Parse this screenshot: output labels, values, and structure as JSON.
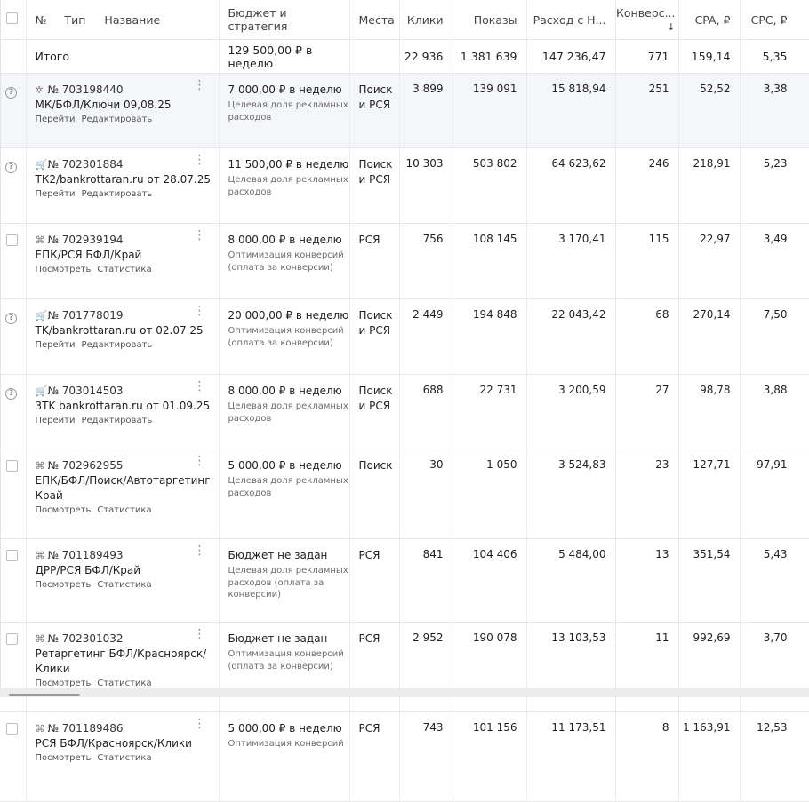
{
  "header": {
    "num": "№",
    "type": "Тип",
    "name": "Название",
    "budget": "Бюджет и стратегия",
    "places": "Места",
    "clicks": "Клики",
    "shows": "Показы",
    "spend": "Расход с Н...",
    "conv": "Конверс...",
    "sort_icon": "↓",
    "cpa": "CPA, ₽",
    "cpc": "CPC, ₽"
  },
  "total": {
    "label": "Итого",
    "budget": "129 500,00 ₽ в неделю",
    "clicks": "22 936",
    "shows": "1 381 639",
    "spend": "147 236,47",
    "conv": "771",
    "cpa": "159,14",
    "cpc": "5,35"
  },
  "rows": [
    {
      "status": "question-icon",
      "type_icon": "✲",
      "id": "№ 703198440",
      "name": "МК/БФЛ/Ключи 09,08.25",
      "link1": "Перейти",
      "link2": "Редактировать",
      "budget": "7 000,00 ₽ в неделю",
      "strategy": "Целевая доля рекламных расходов",
      "places": "Поиск и РСЯ",
      "clicks": "3 899",
      "shows": "139 091",
      "spend": "15 818,94",
      "conv": "251",
      "cpa": "52,52",
      "cpc": "3,38"
    },
    {
      "status": "question-icon",
      "type_icon": "🛒",
      "id": "№ 702301884",
      "name": "ТК2/bankrottaran.ru от 28.07.25",
      "link1": "Перейти",
      "link2": "Редактировать",
      "budget": "11 500,00 ₽ в неделю",
      "strategy": "Целевая доля рекламных расходов",
      "places": "Поиск и РСЯ",
      "clicks": "10 303",
      "shows": "503 802",
      "spend": "64 623,62",
      "conv": "246",
      "cpa": "218,91",
      "cpc": "5,23"
    },
    {
      "status": "checkbox",
      "type_icon": "⌘",
      "id": "№ 702939194",
      "name": "ЕПК/РСЯ БФЛ/Край",
      "link1": "Посмотреть",
      "link2": "Статистика",
      "budget": "8 000,00 ₽ в неделю",
      "strategy": "Оптимизация конверсий (оплата за конверсии)",
      "places": "РСЯ",
      "clicks": "756",
      "shows": "108 145",
      "spend": "3 170,41",
      "conv": "115",
      "cpa": "22,97",
      "cpc": "3,49"
    },
    {
      "status": "question-icon",
      "type_icon": "🛒",
      "id": "№ 701778019",
      "name": "TK/bankrottaran.ru от 02.07.25",
      "link1": "Перейти",
      "link2": "Редактировать",
      "budget": "20 000,00 ₽ в неделю",
      "strategy": "Оптимизация конверсий (оплата за конверсии)",
      "places": "Поиск и РСЯ",
      "clicks": "2 449",
      "shows": "194 848",
      "spend": "22 043,42",
      "conv": "68",
      "cpa": "270,14",
      "cpc": "7,50"
    },
    {
      "status": "question-icon",
      "type_icon": "🛒",
      "id": "№ 703014503",
      "name": "3TK bankrottaran.ru от 01.09.25",
      "link1": "Перейти",
      "link2": "Редактировать",
      "budget": "8 000,00 ₽ в неделю",
      "strategy": "Целевая доля рекламных расходов",
      "places": "Поиск и РСЯ",
      "clicks": "688",
      "shows": "22 731",
      "spend": "3 200,59",
      "conv": "27",
      "cpa": "98,78",
      "cpc": "3,88"
    },
    {
      "status": "checkbox",
      "type_icon": "⌘",
      "id": "№ 702962955",
      "name": "ЕПК/БФЛ/Поиск/Автотаргетинг Край",
      "link1": "Посмотреть",
      "link2": "Статистика",
      "budget": "5 000,00 ₽ в неделю",
      "strategy": "Целевая доля рекламных расходов",
      "places": "Поиск",
      "clicks": "30",
      "shows": "1 050",
      "spend": "3 524,83",
      "conv": "23",
      "cpa": "127,71",
      "cpc": "97,91"
    },
    {
      "status": "checkbox",
      "type_icon": "⌘",
      "id": "№ 701189493",
      "name": "ДРР/РСЯ БФЛ/Край",
      "link1": "Посмотреть",
      "link2": "Статистика",
      "budget": "Бюджет не задан",
      "strategy": "Целевая доля рекламных расходов (оплата за конверсии)",
      "places": "РСЯ",
      "clicks": "841",
      "shows": "104 406",
      "spend": "5 484,00",
      "conv": "13",
      "cpa": "351,54",
      "cpc": "5,43"
    },
    {
      "status": "checkbox",
      "type_icon": "⌘",
      "id": "№ 702301032",
      "name": "Ретаргетинг БФЛ/Красноярск/ Клики",
      "link1": "Посмотреть",
      "link2": "Статистика",
      "budget": "Бюджет не задан",
      "strategy": "Оптимизация конверсий (оплата за конверсии)",
      "places": "РСЯ",
      "clicks": "2 952",
      "shows": "190 078",
      "spend": "13 103,53",
      "conv": "11",
      "cpa": "992,69",
      "cpc": "3,70"
    },
    {
      "status": "checkbox",
      "type_icon": "⌘",
      "id": "№ 701189486",
      "name": "РСЯ БФЛ/Красноярск/Клики",
      "link1": "Посмотреть",
      "link2": "Статистика",
      "budget": "5 000,00 ₽ в неделю",
      "strategy": "Оптимизация конверсий",
      "places": "РСЯ",
      "clicks": "743",
      "shows": "101 156",
      "spend": "11 173,51",
      "conv": "8",
      "cpa": "1 163,91",
      "cpc": "12,53"
    }
  ]
}
